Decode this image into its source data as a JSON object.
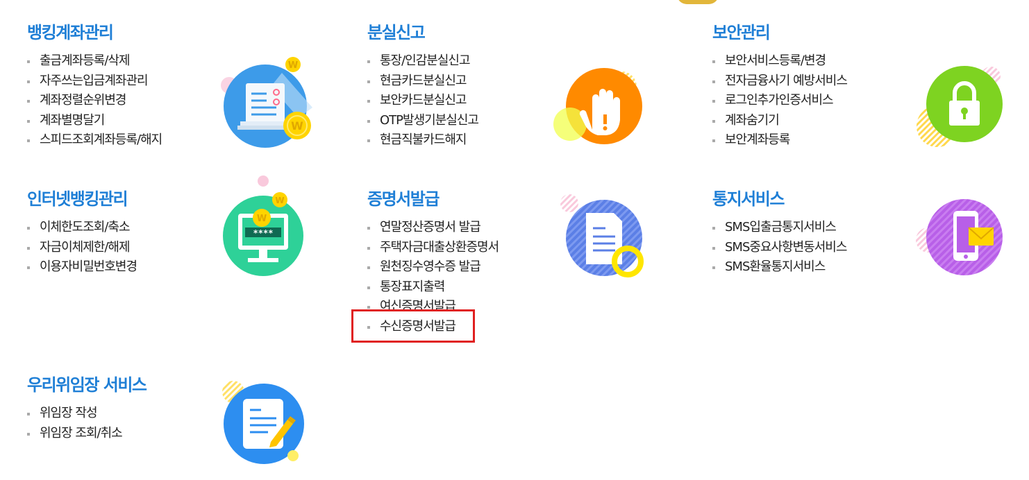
{
  "sections": {
    "banking_account": {
      "title": "뱅킹계좌관리",
      "items": [
        "출금계좌등록/삭제",
        "자주쓰는입금계좌관리",
        "계좌정렬순위변경",
        "계좌별명달기",
        "스피드조회계좌등록/해지"
      ]
    },
    "loss_report": {
      "title": "분실신고",
      "items": [
        "통장/인감분실신고",
        "현금카드분실신고",
        "보안카드분실신고",
        "OTP발생기분실신고",
        "현금직불카드해지"
      ]
    },
    "security": {
      "title": "보안관리",
      "items": [
        "보안서비스등록/변경",
        "전자금융사기 예방서비스",
        "로그인추가인증서비스",
        "계좌숨기기",
        "보안계좌등록"
      ]
    },
    "internet_banking": {
      "title": "인터넷뱅킹관리",
      "items": [
        "이체한도조회/축소",
        "자금이체제한/해제",
        "이용자비밀번호변경"
      ]
    },
    "certificate": {
      "title": "증명서발급",
      "items": [
        "연말정산증명서 발급",
        "주택자금대출상환증명서",
        "원천징수영수증 발급",
        "통장표지출력",
        "여신증명서발급",
        "수신증명서발급"
      ]
    },
    "notification": {
      "title": "통지서비스",
      "items": [
        "SMS입출금통지서비스",
        "SMS중요사항변동서비스",
        "SMS환율통지서비스"
      ]
    },
    "power_of_attorney": {
      "title": "우리위임장 서비스",
      "items": [
        "위임장 작성",
        "위임장 조회/취소"
      ]
    }
  },
  "icons": {
    "coin_symbol": "W",
    "password_mask": "****"
  },
  "colors": {
    "title_blue": "#1f7fd6",
    "banking_icon": "#3d9be9",
    "loss_icon": "#ff8a00",
    "security_icon": "#7ed321",
    "internet_icon": "#2ed198",
    "certificate_icon": "#5b7fe6",
    "notification_icon": "#b85fe8",
    "attorney_icon": "#2d8ef0",
    "highlight_border": "#e02020"
  }
}
